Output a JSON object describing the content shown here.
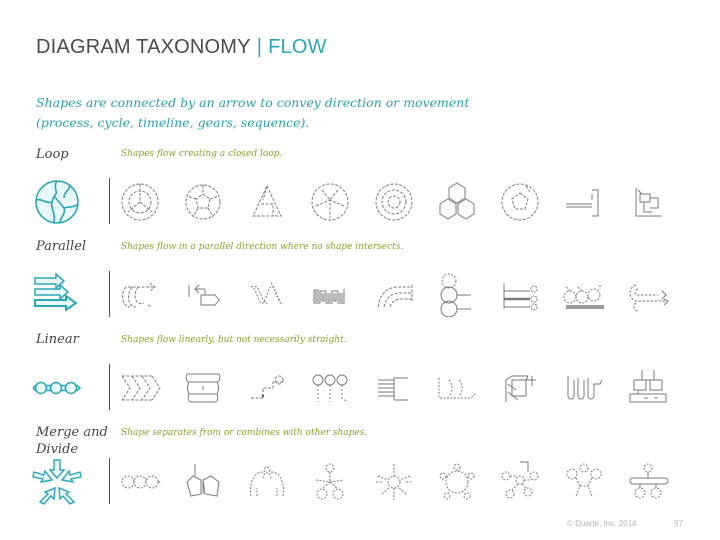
{
  "header": {
    "title": "DIAGRAM TAXONOMY",
    "separator": "|",
    "section": "FLOW"
  },
  "intro": {
    "line1": "Shapes are connected by an arrow to convey direction or movement",
    "line2": "(process, cycle, timeline, gears, sequence)."
  },
  "colors": {
    "accent": "#2aa6b8",
    "description": "#8aa12a",
    "title": "#4a4a4a",
    "icon_stroke": "#7a7a7a"
  },
  "categories": [
    {
      "label": "Loop",
      "description": "Shapes flow creating a closed loop.",
      "hero_icon": "loop-circle-icon",
      "examples": [
        "circular-cycle-icon",
        "segmented-circle-icon",
        "triangle-cycle-icon",
        "petal-cycle-icon",
        "concentric-cycle-icon",
        "hexagon-cycle-icon",
        "arrow-ring-icon",
        "bracket-loop-icon",
        "puzzle-loop-icon"
      ]
    },
    {
      "label": "Parallel",
      "description": "Shapes flow in a parallel direction where no shape intersects.",
      "hero_icon": "parallel-arrows-icon",
      "examples": [
        "parallel-swirl-icon",
        "parallel-box-arrow-icon",
        "parallel-wave-icon",
        "parallel-zigzag-icon",
        "parallel-curves-icon",
        "stacked-circles-icon",
        "parallel-bars-icon",
        "parallel-drops-icon",
        "parallel-loops-icon"
      ]
    },
    {
      "label": "Linear",
      "description": "Shapes flow linearly, but not necessarily straight.",
      "hero_icon": "linear-chain-icon",
      "examples": [
        "chevron-sequence-icon",
        "stacked-banners-icon",
        "step-path-icon",
        "balloon-sequence-icon",
        "list-bracket-icon",
        "linear-arcs-icon",
        "cube-steps-icon",
        "tube-steps-icon",
        "org-blocks-icon"
      ]
    },
    {
      "label": "Merge and Divide",
      "description": "Shape separates from or combines with other shapes.",
      "hero_icon": "merge-arrows-icon",
      "examples": [
        "chain-links-icon",
        "split-shapes-icon",
        "arc-split-icon",
        "radial-merge-icon",
        "radial-burst-icon",
        "ring-merge-icon",
        "hub-spokes-icon",
        "converge-circles-icon",
        "bar-split-icon"
      ]
    }
  ],
  "footer": {
    "copyright": "© Duarte, Inc. 2014",
    "page_number": "97"
  }
}
